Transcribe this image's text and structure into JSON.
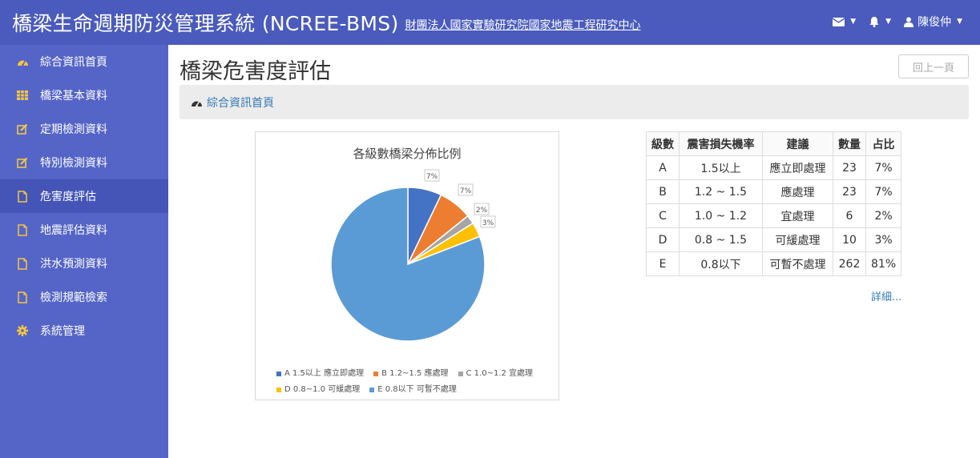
{
  "header": {
    "brand": "橋梁生命週期防災管理系統 (NCREE-BMS)",
    "org": "財團法人國家實驗研究院國家地震工程研究中心",
    "user": "陳俊仲"
  },
  "sidebar": {
    "items": [
      {
        "label": "綜合資訊首頁",
        "icon": "dashboard-icon"
      },
      {
        "label": "橋梁基本資料",
        "icon": "table-icon"
      },
      {
        "label": "定期檢測資料",
        "icon": "edit-icon"
      },
      {
        "label": "特別檢測資料",
        "icon": "edit-icon"
      },
      {
        "label": "危害度評估",
        "icon": "file-icon",
        "active": true
      },
      {
        "label": "地震評估資料",
        "icon": "file-icon"
      },
      {
        "label": "洪水預測資料",
        "icon": "file-icon"
      },
      {
        "label": "檢測規範檢索",
        "icon": "file-icon"
      },
      {
        "label": "系統管理",
        "icon": "gear-icon"
      }
    ]
  },
  "page": {
    "title": "橋梁危害度評估",
    "back_label": "回上一頁",
    "breadcrumb": "綜合資訊首頁",
    "details_link": "詳細..."
  },
  "table": {
    "headers": [
      "級數",
      "震害損失機率",
      "建議",
      "數量",
      "占比"
    ],
    "rows": [
      [
        "A",
        "1.5以上",
        "應立即處理",
        "23",
        "7%"
      ],
      [
        "B",
        "1.2 ~ 1.5",
        "應處理",
        "23",
        "7%"
      ],
      [
        "C",
        "1.0 ~ 1.2",
        "宜處理",
        "6",
        "2%"
      ],
      [
        "D",
        "0.8 ~ 1.5",
        "可緩處理",
        "10",
        "3%"
      ],
      [
        "E",
        "0.8以下",
        "可暫不處理",
        "262",
        "81%"
      ]
    ]
  },
  "chart_data": {
    "type": "pie",
    "title": "各級數橋梁分佈比例",
    "categories": [
      "A 1.5以上 應立即處理",
      "B 1.2~1.5 應處理",
      "C 1.0~1.2 宜處理",
      "D 0.8~1.0 可緩處理",
      "E 0.8以下 可暫不處理"
    ],
    "values": [
      23,
      23,
      6,
      10,
      262
    ],
    "labels": [
      "7%",
      "7%",
      "2%",
      "3%",
      "81%"
    ],
    "colors": [
      "#4472c4",
      "#ed7d31",
      "#a5a5a5",
      "#ffc000",
      "#5b9bd5"
    ],
    "legend": "bottom"
  },
  "colors": {
    "topbar": "#4a5bbd",
    "sidebar": "#5565c7",
    "sidebar_active": "#4555b7",
    "link": "#337ab7"
  }
}
